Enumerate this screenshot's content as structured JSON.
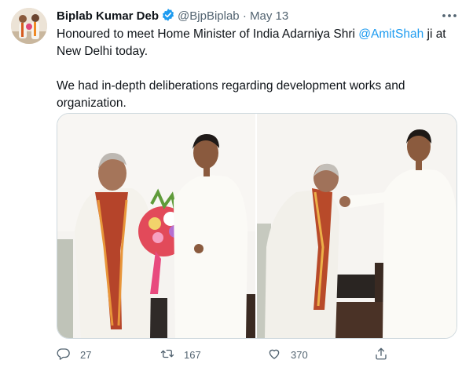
{
  "author": {
    "name": "Biplab Kumar Deb",
    "handle": "@BjpBiplab",
    "separator": "·",
    "date": "May 13"
  },
  "tweet": {
    "line1_before": "Honoured to meet Home Minister of India Adarniya Shri ",
    "mention": "@AmitShah",
    "line1_after": " ji at New Delhi today.",
    "paragraph2": "We had in-depth deliberations regarding development works and organization."
  },
  "actions": {
    "reply_count": "27",
    "retweet_count": "167",
    "like_count": "370"
  },
  "icons": [
    "verified-badge-icon",
    "more-icon",
    "reply-icon",
    "retweet-icon",
    "like-icon",
    "share-icon"
  ],
  "colors": {
    "accent": "#1d9bf0",
    "muted": "#536471",
    "text": "#0f1419",
    "border": "#cfd9de"
  }
}
